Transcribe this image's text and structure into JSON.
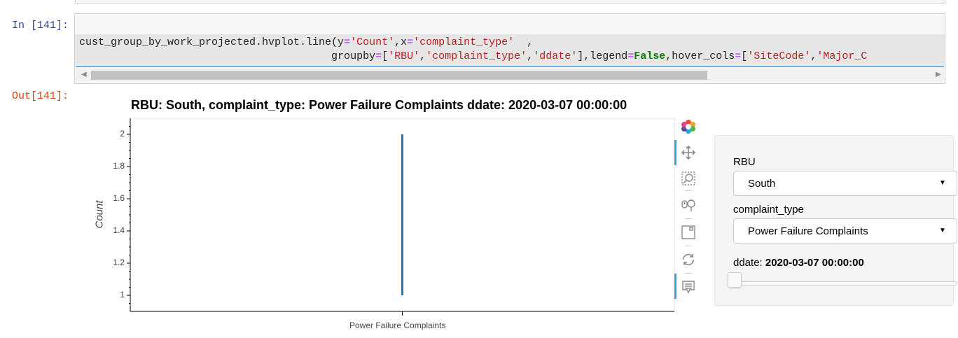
{
  "notebook": {
    "in_prompt": "In [141]:",
    "out_prompt": "Out[141]:"
  },
  "code": {
    "line1": {
      "a": "cust_group_by_work_projected.hvplot.line(y",
      "b": "=",
      "c": "'Count'",
      "d": ",x",
      "e": "=",
      "f": "'complaint_type'",
      "g": "  ,"
    },
    "line2": {
      "a": "                                        groupby",
      "b": "=",
      "c": "[",
      "d": "'RBU'",
      "e": ",",
      "f": "'complaint_type'",
      "g": ",",
      "h": "'ddate'",
      "i": "],legend",
      "j": "=",
      "k": "False",
      "l": ",hover_cols",
      "m": "=",
      "n": "[",
      "o": "'SiteCode'",
      "p": ",",
      "q": "'Major_C"
    }
  },
  "plot": {
    "title": "RBU: South, complaint_type: Power Failure Complaints ddate: 2020-03-07 00:00:00",
    "line_color": "#1f77b4",
    "active_tool_color": "#26aae1"
  },
  "chart_data": {
    "type": "line",
    "title": "RBU: South, complaint_type: Power Failure Complaints ddate: 2020-03-07 00:00:00",
    "xlabel": "",
    "ylabel": "Count",
    "categories": [
      "Power Failure Complaints"
    ],
    "ylim": [
      0.9,
      2.1
    ],
    "y_ticks": [
      "2",
      "1.8",
      "1.6",
      "1.4",
      "1.2",
      "1"
    ],
    "y_tick_values": [
      2,
      1.8,
      1.6,
      1.4,
      1.2,
      1
    ],
    "series": [
      {
        "values": [
          1,
          2
        ],
        "x": [
          "Power Failure Complaints",
          "Power Failure Complaints"
        ]
      }
    ],
    "grid": false,
    "legend": false
  },
  "toolbar": {
    "tools": [
      "bokeh-logo-icon",
      "pan-icon",
      "box-zoom-icon",
      "wheel-zoom-icon",
      "save-icon",
      "reset-icon",
      "hover-icon"
    ]
  },
  "widgets": {
    "rbu_label": "RBU",
    "rbu_value": "South",
    "complaint_type_label": "complaint_type",
    "complaint_type_value": "Power Failure Complaints",
    "ddate_label": "ddate: ",
    "ddate_value": "2020-03-07 00:00:00"
  }
}
